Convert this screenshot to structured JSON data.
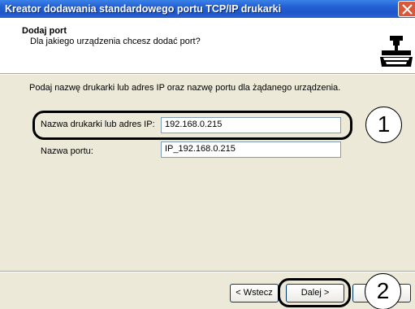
{
  "window": {
    "title": "Kreator dodawania standardowego portu TCP/IP drukarki"
  },
  "header": {
    "title": "Dodaj port",
    "subtitle": "Dla jakiego urządzenia chcesz dodać port?",
    "icon": "printer-network-icon"
  },
  "content": {
    "instruction": "Podaj nazwę drukarki lub adres IP oraz nazwę portu dla żądanego urządzenia.",
    "printer_label": "Nazwa drukarki lub adres IP:",
    "printer_value": "192.168.0.215",
    "port_label": "Nazwa portu:",
    "port_value": "IP_192.168.0.215"
  },
  "callouts": {
    "one": "1",
    "two": "2"
  },
  "buttons": {
    "back_label": "< Wstecz",
    "next_label": "Dalej >"
  },
  "colors": {
    "titlebar": "#2462d5",
    "dialog_bg": "#ece9d8",
    "field_border": "#7f9db9"
  }
}
